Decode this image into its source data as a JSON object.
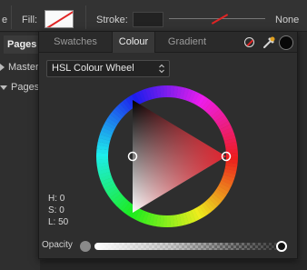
{
  "toolbar": {
    "prev_label": "e",
    "fill_label": "Fill:",
    "stroke_label": "Stroke:",
    "stroke_style_value": "None"
  },
  "left_panel": {
    "tab_label": "Pages",
    "items": [
      {
        "label": "Master"
      },
      {
        "label": "Pages"
      }
    ]
  },
  "colour_panel": {
    "tabs": [
      {
        "label": "Swatches",
        "active": false
      },
      {
        "label": "Colour",
        "active": true
      },
      {
        "label": "Gradient",
        "active": false
      }
    ],
    "model_dropdown": "HSL Colour Wheel",
    "hsl": {
      "h": "H: 0",
      "s": "S: 0",
      "l": "L: 50"
    },
    "opacity_label": "Opacity",
    "opacity_value": 1.0,
    "current_colour": "#080808",
    "hue_colour": "#e0242f"
  },
  "icons": {
    "none_swatch": "none-color-icon",
    "eyedropper": "eyedropper-icon",
    "dropdown_arrows": "updown-chevron-icon"
  }
}
